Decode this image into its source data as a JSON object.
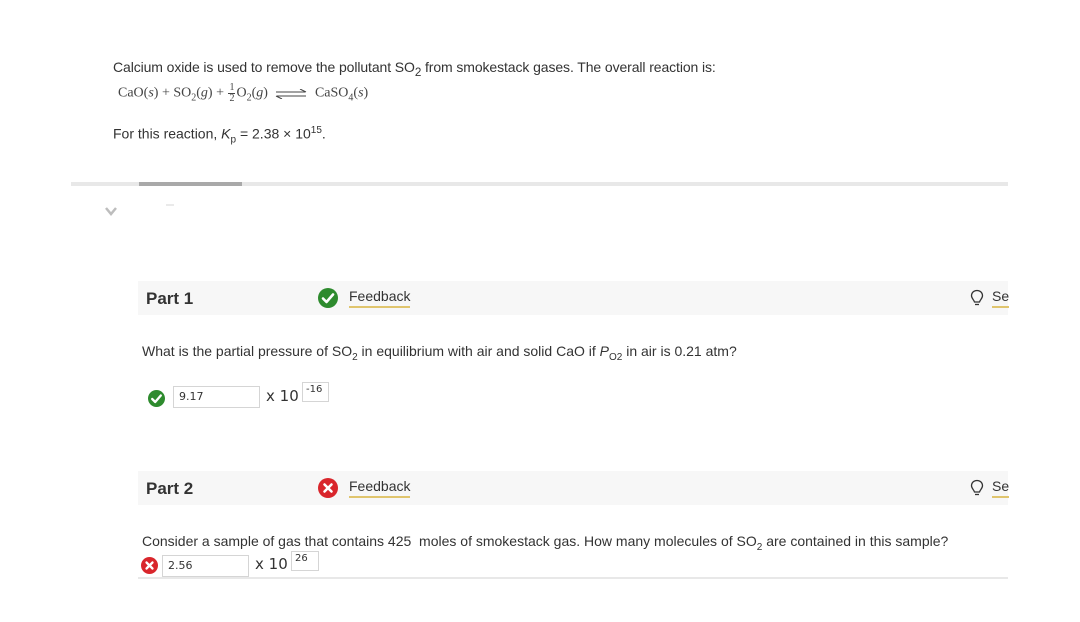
{
  "problem": {
    "intro_prefix": "Calcium oxide is used to remove the pollutant SO",
    "intro_sub": "2",
    "intro_suffix": " from smokestack gases. The overall reaction is:",
    "equation": {
      "cao": "CaO(",
      "s1": "s",
      "close1": ") + SO",
      "so2_sub": "2",
      "g1_open": "(",
      "g1": "g",
      "close2": ") + ",
      "frac_num": "1",
      "frac_den": "2",
      "o2": "O",
      "o2_sub": "2",
      "g2_open": "(",
      "g2": "g",
      "close3": ")",
      "caso4": "CaSO",
      "caso4_sub": "4",
      "s2_open": "(",
      "s2": "s",
      "close4": ")"
    },
    "kp_prefix": "For this reaction, ",
    "kp_symbol": "K",
    "kp_sub": "p",
    "kp_value": " = 2.38 × 10",
    "kp_exp": "15",
    "kp_end": "."
  },
  "progress": {
    "fraction": 0.11
  },
  "parts": [
    {
      "title": "Part 1",
      "status": "correct",
      "feedback_label": "Feedback",
      "hint_label": "Se",
      "question": {
        "prefix": "What is the partial pressure of SO",
        "sub1": "2",
        "middle": " in equilibrium with air and solid CaO if ",
        "p_symbol": "P",
        "p_sub": "O2",
        "suffix": " in air is 0.21 atm?"
      },
      "answer": {
        "mantissa": "9.17",
        "times_label": "x 10",
        "exponent": "-16"
      }
    },
    {
      "title": "Part 2",
      "status": "incorrect",
      "feedback_label": "Feedback",
      "hint_label": "Se",
      "question": {
        "prefix": "Consider a sample of gas that contains 425  moles of smokestack gas. How many molecules of SO",
        "sub1": "2",
        "suffix": " are contained in this sample?"
      },
      "answer": {
        "mantissa": "2.56",
        "times_label": "x 10",
        "exponent": "26"
      }
    }
  ],
  "colors": {
    "correct": "#2e8b2e",
    "incorrect": "#d9262c",
    "link_underline": "#e0c56e"
  }
}
